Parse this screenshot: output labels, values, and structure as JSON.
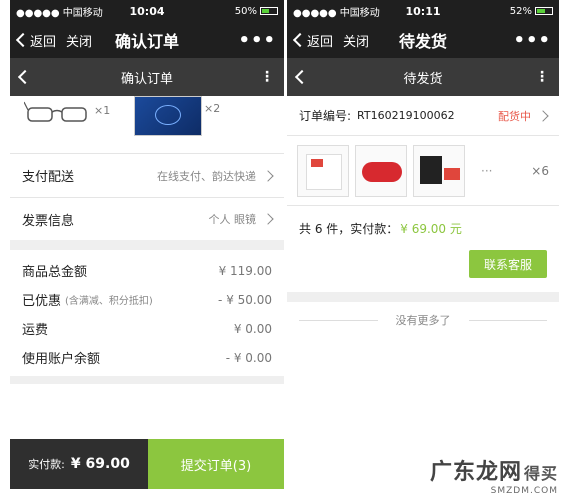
{
  "left": {
    "status": {
      "carrier": "●●●●● 中国移动 ",
      "time": "10:04",
      "battery": "50%"
    },
    "wx_nav": {
      "back": "返回",
      "close": "关闭",
      "title": "确认订单",
      "more": "•••"
    },
    "app_nav": {
      "title": "确认订单",
      "more": "⋮"
    },
    "products": {
      "qty1": "×1",
      "qty2": "×2"
    },
    "payment": {
      "label": "支付配送",
      "value": "在线支付、韵达快递"
    },
    "invoice": {
      "label": "发票信息",
      "value": "个人 眼镜"
    },
    "summary": [
      {
        "label": "商品总金额",
        "sub": "",
        "value": "¥ 119.00"
      },
      {
        "label": "已优惠",
        "sub": "(含满减、积分抵扣)",
        "value": "- ¥ 50.00"
      },
      {
        "label": "运费",
        "sub": "",
        "value": "¥ 0.00"
      },
      {
        "label": "使用账户余额",
        "sub": "",
        "value": "- ¥ 0.00"
      }
    ],
    "bottom": {
      "paid_label": "实付款:",
      "paid_value": "¥ 69.00",
      "submit": "提交订单(3)"
    }
  },
  "right": {
    "status": {
      "carrier": "●●●●● 中国移动 ",
      "time": "10:11",
      "battery": "52%"
    },
    "wx_nav": {
      "back": "返回",
      "close": "关闭",
      "title": "待发货",
      "more": "•••"
    },
    "app_nav": {
      "title": "待发货",
      "more": "⋮"
    },
    "order": {
      "label": "订单编号:",
      "number": "RT160219100062",
      "status": "配货中"
    },
    "items": {
      "ellipsis": "···",
      "count": "×6"
    },
    "total": {
      "text": "共 6 件，实付款：",
      "price": "¥ 69.00 元"
    },
    "contact_button": "联系客服",
    "no_more": "没有更多了"
  },
  "watermark": {
    "brand": "广东龙网",
    "suffix": "得买",
    "url": "SMZDM.COM"
  },
  "colors": {
    "accent_green": "#8cc63f",
    "status_red": "#e8584a",
    "dark_bar": "#1f1f1f"
  }
}
